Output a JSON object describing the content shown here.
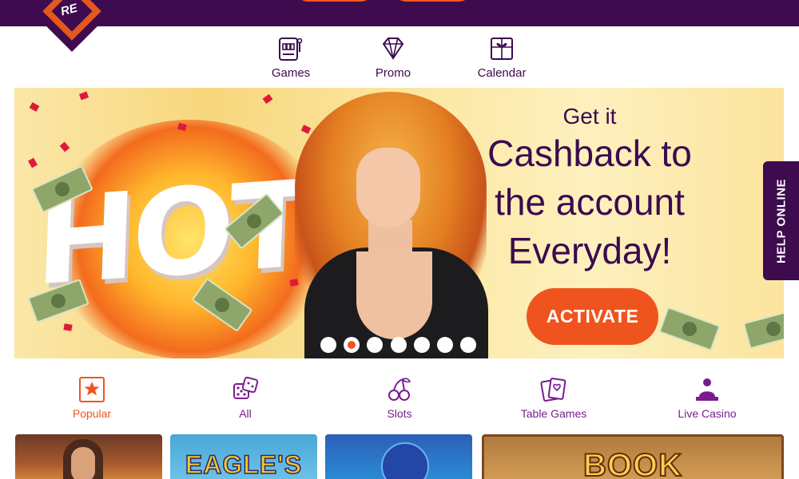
{
  "header": {
    "logo_text": "RE",
    "logo_icon": "slots-diamond-logo"
  },
  "topnav": [
    {
      "label": "Games",
      "icon": "slot-machine-icon"
    },
    {
      "label": "Promo",
      "icon": "diamond-icon"
    },
    {
      "label": "Calendar",
      "icon": "gift-calendar-icon"
    }
  ],
  "banner": {
    "hot_text": "HOT",
    "line1": "Get it",
    "line2": "Cashback to",
    "line3": "the account",
    "line4": "Everyday!",
    "button": "ACTIVATE",
    "slide_count": 7,
    "active_slide": 2
  },
  "help": {
    "label": "HELP ONLINE"
  },
  "categories": [
    {
      "label": "Popular",
      "icon": "star-icon",
      "active": true
    },
    {
      "label": "All",
      "icon": "dice-icon",
      "active": false
    },
    {
      "label": "Slots",
      "icon": "cherry-icon",
      "active": false
    },
    {
      "label": "Table Games",
      "icon": "cards-icon",
      "active": false
    },
    {
      "label": "Live Casino",
      "icon": "dealer-icon",
      "active": false
    }
  ],
  "games": [
    {
      "title": ""
    },
    {
      "title": "EAGLE'S"
    },
    {
      "title": ""
    },
    {
      "title": "BOOK"
    }
  ],
  "colors": {
    "brand": "#3d0b4e",
    "accent": "#f0541e",
    "category_text": "#7a1c8e"
  }
}
